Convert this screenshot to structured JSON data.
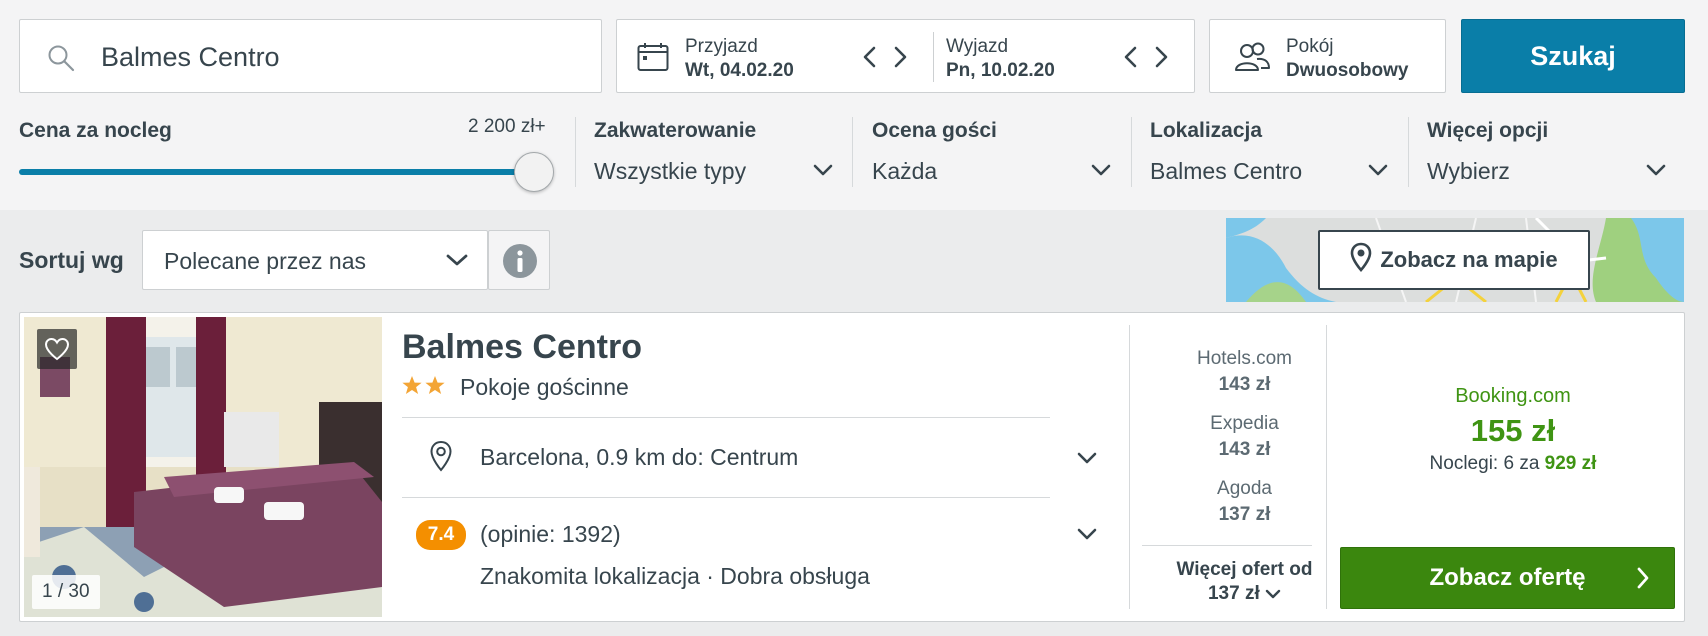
{
  "search": {
    "value": "Balmes Centro"
  },
  "dates": {
    "checkin_label": "Przyjazd",
    "checkin_value": "Wt, 04.02.20",
    "checkout_label": "Wyjazd",
    "checkout_value": "Pn, 10.02.20"
  },
  "room": {
    "label": "Pokój",
    "value": "Dwuosobowy"
  },
  "search_button": "Szukaj",
  "filters": {
    "price": {
      "label": "Cena za nocleg",
      "max_label": "2 200 zł+",
      "level_percent": 100
    },
    "accommodation": {
      "label": "Zakwaterowanie",
      "value": "Wszystkie typy"
    },
    "rating": {
      "label": "Ocena gości",
      "value": "Każda"
    },
    "location": {
      "label": "Lokalizacja",
      "value": "Balmes Centro"
    },
    "more": {
      "label": "Więcej opcji",
      "value": "Wybierz"
    }
  },
  "sort": {
    "label": "Sortuj wg",
    "value": "Polecane przez nas"
  },
  "map_button": "Zobacz na mapie",
  "hotel": {
    "name": "Balmes Centro",
    "stars": 2,
    "type": "Pokoje gościnne",
    "location": "Barcelona, 0.9 km do: Centrum",
    "score": "7.4",
    "reviews": "(opinie: 1392)",
    "highlights": "Znakomita lokalizacja · Dobra obsługa",
    "photo_counter": "1 / 30",
    "providers": [
      {
        "name": "Hotels.com",
        "price": "143 zł"
      },
      {
        "name": "Expedia",
        "price": "143 zł"
      },
      {
        "name": "Agoda",
        "price": "137 zł"
      }
    ],
    "more_offers_line1": "Więcej ofert od",
    "more_offers_line2": "137 zł",
    "best_deal": {
      "provider": "Booking.com",
      "price": "155 zł",
      "nights_text": "Noclegi: 6 za",
      "nights_total": "929 zł"
    },
    "deal_button": "Zobacz ofertę"
  },
  "colors": {
    "primary_blue": "#0a7ea8",
    "deal_green": "#3b870e",
    "score_orange": "#f48f00",
    "star_gold": "#f3a536"
  }
}
